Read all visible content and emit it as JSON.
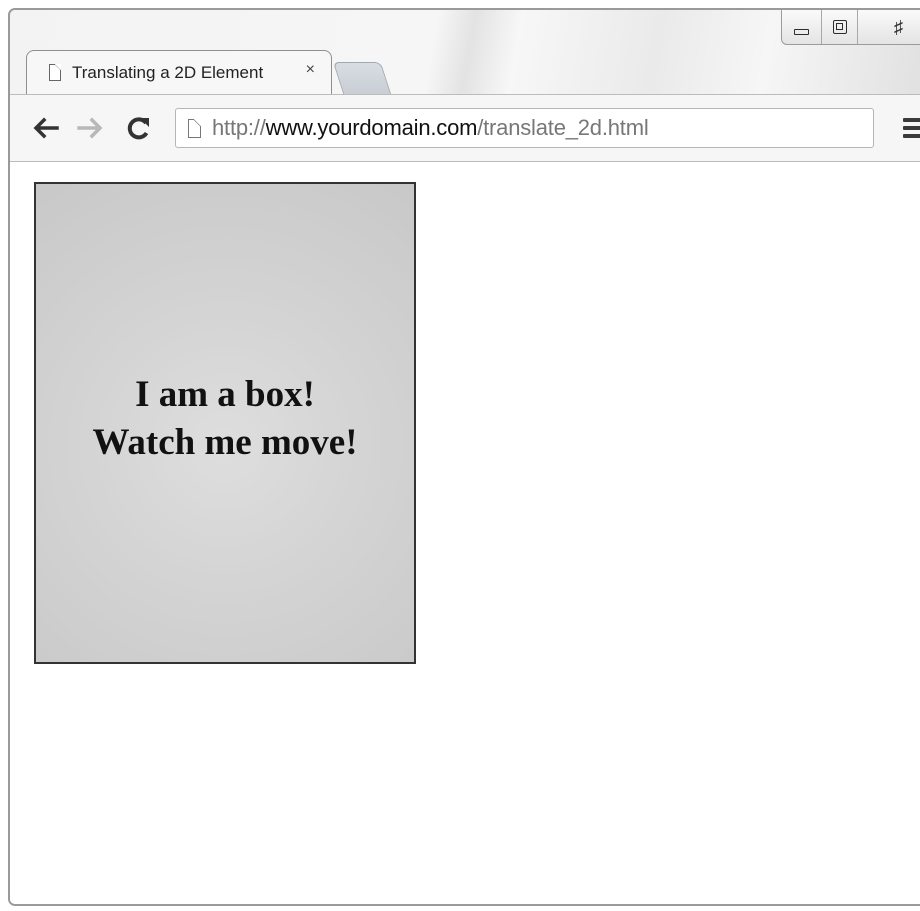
{
  "browser": {
    "tab": {
      "title": "Translating a 2D Element",
      "close_label": "×"
    },
    "window_controls": {
      "minimize_icon": "minimize-icon",
      "maximize_icon": "maximize-icon",
      "close_label": "♯"
    },
    "toolbar": {
      "back_icon": "arrow-left-icon",
      "forward_icon": "arrow-right-icon",
      "reload_icon": "reload-icon",
      "menu_icon": "menu-icon"
    },
    "address": {
      "scheme": "http://",
      "domain": "www.yourdomain.com",
      "path": "/translate_2d.html"
    }
  },
  "page": {
    "box": {
      "line1": "I am a box!",
      "line2": "Watch me move!"
    }
  },
  "colors": {
    "box_background": "#d3d3d3",
    "box_border": "#333333",
    "browser_chrome": "#f6f6f6",
    "url_muted": "#777777"
  }
}
